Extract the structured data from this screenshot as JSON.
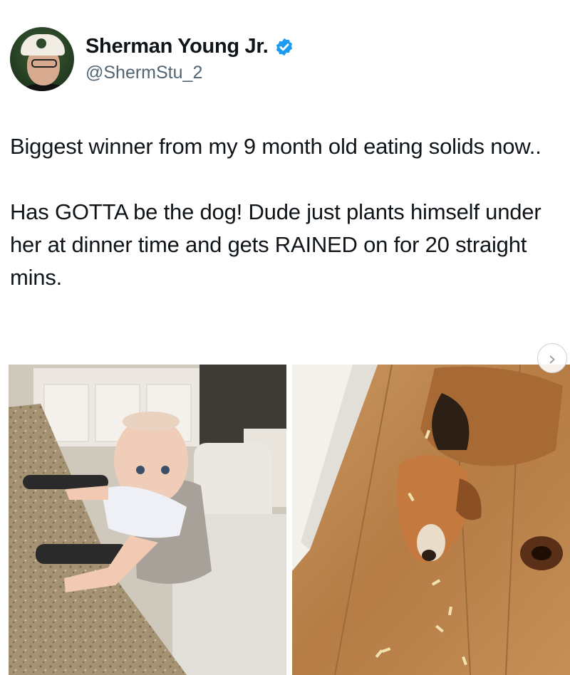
{
  "author": {
    "display_name": "Sherman Young Jr.",
    "handle": "@ShermStu_2",
    "verified": true,
    "verified_badge_color": "#1d9bf0",
    "avatar_icon": "profile-avatar"
  },
  "tweet": {
    "text": "Biggest winner from my 9 month old eating solids now..\n\nHas GOTTA be the dog! Dude just plants himself under her at dinner time and gets RAINED on for 20 straight mins."
  },
  "media": {
    "images": [
      {
        "description_icon": "baby-in-high-chair-photo"
      },
      {
        "description_icon": "dog-on-wood-floor-photo"
      }
    ],
    "next_icon": "chevron-right-icon",
    "next_glyph": "›"
  }
}
